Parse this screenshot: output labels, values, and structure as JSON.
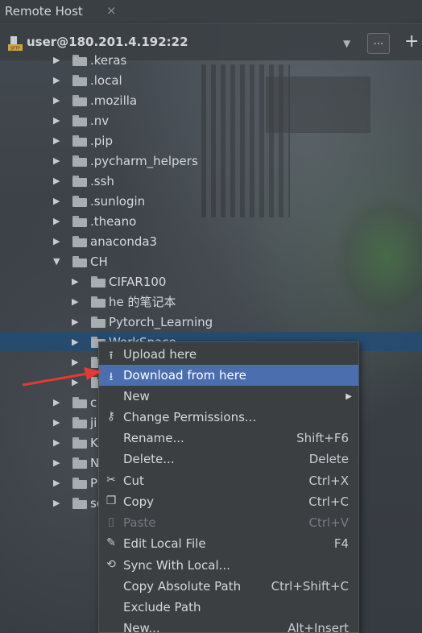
{
  "window": {
    "tab_title": "Remote Host",
    "tab_close": "×"
  },
  "host": {
    "label": "user@180.201.4.192:22",
    "more_label": "...",
    "add_label": "+",
    "icon": "sftp-icon",
    "icon_text": "SFTP"
  },
  "tree": {
    "items": [
      {
        "name": ".keras",
        "arrow": "▶"
      },
      {
        "name": ".local",
        "arrow": "▶"
      },
      {
        "name": ".mozilla",
        "arrow": "▶"
      },
      {
        "name": ".nv",
        "arrow": "▶"
      },
      {
        "name": ".pip",
        "arrow": "▶"
      },
      {
        "name": ".pycharm_helpers",
        "arrow": "▶"
      },
      {
        "name": ".ssh",
        "arrow": "▶"
      },
      {
        "name": ".sunlogin",
        "arrow": "▶"
      },
      {
        "name": ".theano",
        "arrow": "▶"
      },
      {
        "name": "anaconda3",
        "arrow": "▶"
      },
      {
        "name": "CH",
        "arrow": "▼"
      },
      {
        "name": "CIFAR100",
        "arrow": "▶"
      },
      {
        "name": "he 的笔记本",
        "arrow": "▶"
      },
      {
        "name": "Pytorch_Learning",
        "arrow": "▶"
      },
      {
        "name": "WorkSpace",
        "arrow": "▶"
      },
      {
        "name": "",
        "arrow": "▶"
      },
      {
        "name": "",
        "arrow": "▶"
      },
      {
        "name": "c",
        "arrow": "▶"
      },
      {
        "name": "ji",
        "arrow": "▶"
      },
      {
        "name": "K",
        "arrow": "▶"
      },
      {
        "name": "N",
        "arrow": "▶"
      },
      {
        "name": "P",
        "arrow": "▶"
      },
      {
        "name": "sc",
        "arrow": "▶"
      }
    ]
  },
  "context_menu": {
    "items": [
      {
        "label": "Upload here",
        "shortcut": "",
        "icon": "upload-icon",
        "glyph": "⭱"
      },
      {
        "label": "Download from here",
        "shortcut": "",
        "icon": "download-icon",
        "glyph": "⭳"
      },
      {
        "label": "New",
        "shortcut": "",
        "icon": "",
        "glyph": "",
        "submenu": "▶"
      },
      {
        "label": "Change Permissions...",
        "shortcut": "",
        "icon": "key-icon",
        "glyph": "⚷"
      },
      {
        "label": "Rename...",
        "shortcut": "Shift+F6",
        "icon": "",
        "glyph": ""
      },
      {
        "label": "Delete...",
        "shortcut": "Delete",
        "icon": "",
        "glyph": ""
      },
      {
        "label": "Cut",
        "shortcut": "Ctrl+X",
        "icon": "scissors-icon",
        "glyph": "✂"
      },
      {
        "label": "Copy",
        "shortcut": "Ctrl+C",
        "icon": "copy-icon",
        "glyph": "❐"
      },
      {
        "label": "Paste",
        "shortcut": "Ctrl+V",
        "icon": "paste-icon",
        "glyph": "▯"
      },
      {
        "label": "Edit Local File",
        "shortcut": "F4",
        "icon": "pencil-icon",
        "glyph": "✎"
      },
      {
        "label": "Sync With Local...",
        "shortcut": "",
        "icon": "sync-icon",
        "glyph": "⟲"
      },
      {
        "label": "Copy Absolute Path",
        "shortcut": "Ctrl+Shift+C",
        "icon": "",
        "glyph": ""
      },
      {
        "label": "Exclude Path",
        "shortcut": "",
        "icon": "",
        "glyph": ""
      },
      {
        "label": "New...",
        "shortcut": "Alt+Insert",
        "icon": "",
        "glyph": ""
      }
    ]
  },
  "colors": {
    "highlight": "#4b6eaf",
    "selected_row": "#214c76",
    "annotation_arrow": "#e53935"
  }
}
